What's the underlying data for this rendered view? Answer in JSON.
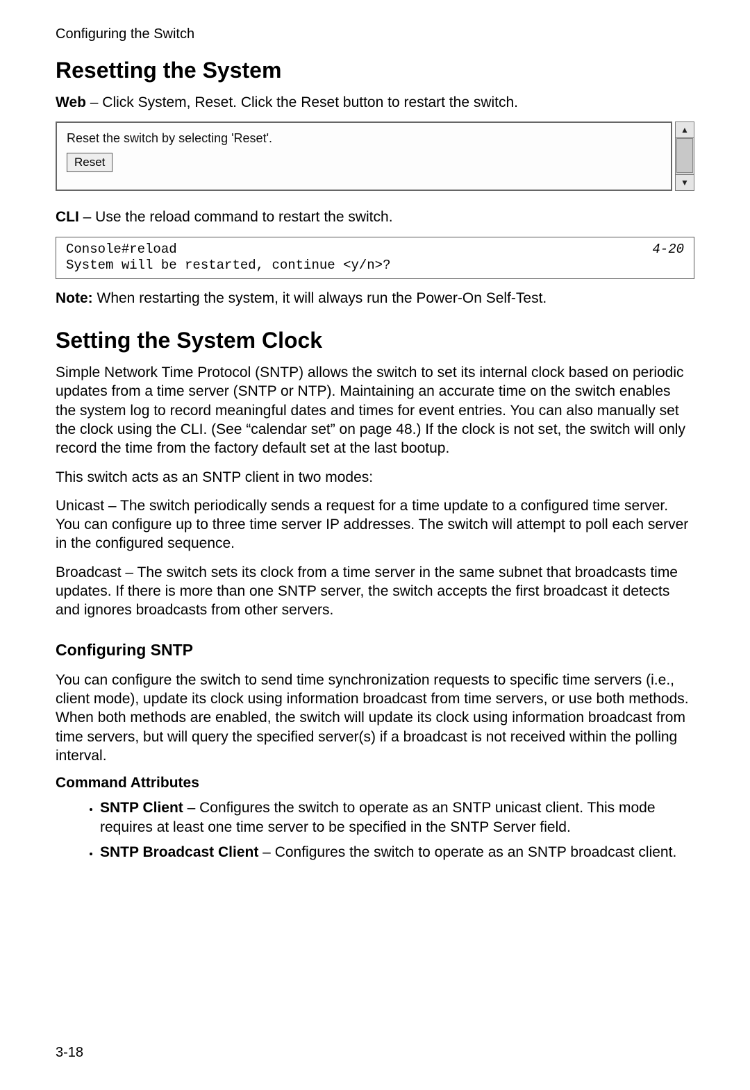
{
  "running_head": "Configuring the Switch",
  "sec1": {
    "title": "Resetting the System",
    "web_label": "Web",
    "web_text": " – Click System, Reset. Click the Reset button to restart the switch.",
    "panel_hint": "Reset the switch by selecting 'Reset'.",
    "reset_btn": "Reset",
    "cli_label": "CLI",
    "cli_text": " – Use the reload command to restart the switch.",
    "cli_lines": "Console#reload\nSystem will be restarted, continue <y/n>?",
    "cli_ref": "4-20",
    "note_label": "Note:",
    "note_text": "   When restarting the system, it will always run the Power-On Self-Test."
  },
  "sec2": {
    "title": "Setting the System Clock",
    "p1": "Simple Network Time Protocol (SNTP) allows the switch to set its internal clock based on periodic updates from a time server (SNTP or NTP). Maintaining an accurate time on the switch enables the system log to record meaningful dates and times for event entries. You can also manually set the clock using the CLI. (See “calendar set” on page 48.) If the clock is not set, the switch will only record the time from the factory default set at the last bootup.",
    "p2": "This switch acts as an SNTP client in two modes:",
    "p3": "Unicast – The switch periodically sends a request for a time update to a configured time server. You can configure up to three time server IP addresses. The switch will attempt to poll each server in the configured sequence.",
    "p4": "Broadcast – The switch sets its clock from a time server in the same subnet that broadcasts time updates. If there is more than one SNTP server, the switch accepts the first broadcast it detects and ignores broadcasts from other servers.",
    "sub_title": "Configuring SNTP",
    "sub_p": "You can configure the switch to send time synchronization requests to specific time servers (i.e., client mode), update its clock using information broadcast from time servers, or use both methods. When both methods are enabled, the switch will update its clock using information broadcast from time servers, but will query the specified server(s) if a broadcast is not received within the polling interval.",
    "cmd_attr_title": "Command Attributes",
    "bullets": [
      {
        "label": "SNTP Client",
        "text": " – Configures the switch to operate as an SNTP unicast client. This mode requires at least one time server to be specified in the SNTP Server field."
      },
      {
        "label": "SNTP Broadcast Client",
        "text": " – Configures the switch to operate as an SNTP broadcast client."
      }
    ]
  },
  "page_number": "3-18"
}
